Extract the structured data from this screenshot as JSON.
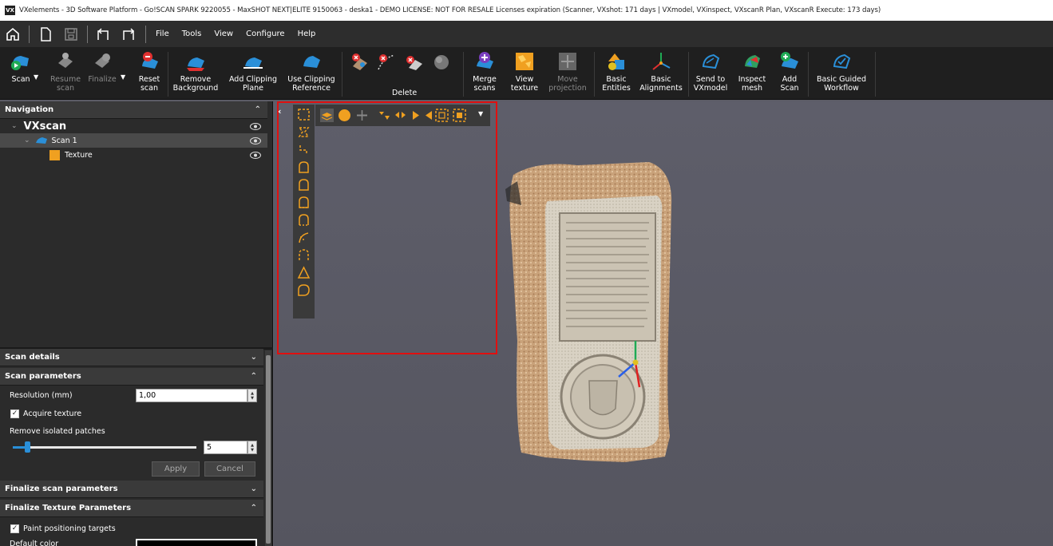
{
  "window": {
    "title": "VXelements - 3D Software Platform - Go!SCAN SPARK 9220055 - MaxSHOT NEXT|ELITE 9150063 - deska1 - DEMO LICENSE: NOT FOR RESALE Licenses expiration (Scanner, VXshot: 171 days | VXmodel, VXinspect, VXscanR Plan, VXscanR Execute: 173 days)",
    "logo": "VX"
  },
  "menu": {
    "items": [
      "File",
      "Tools",
      "View",
      "Configure",
      "Help"
    ]
  },
  "ribbon": {
    "scan": "Scan",
    "resume_scan": "Resume\nscan",
    "finalize": "Finalize",
    "reset_scan": "Reset\nscan",
    "remove_background": "Remove\nBackground",
    "add_clipping_plane": "Add Clipping\nPlane",
    "use_clipping_reference": "Use Clipping\nReference",
    "delete": "Delete",
    "merge_scans": "Merge\nscans",
    "view_texture": "View\ntexture",
    "move_projection": "Move\nprojection",
    "basic_entities": "Basic\nEntities",
    "basic_alignments": "Basic\nAlignments",
    "send_to_vxmodel": "Send to\nVXmodel",
    "inspect_mesh": "Inspect\nmesh",
    "add_scan": "Add\nScan",
    "basic_guided_workflow": "Basic Guided\nWorkflow"
  },
  "navigation": {
    "header": "Navigation",
    "root": "VXscan",
    "scan_item": "Scan 1",
    "texture_item": "Texture"
  },
  "scan_details": {
    "header": "Scan details"
  },
  "scan_parameters": {
    "header": "Scan parameters",
    "resolution_label": "Resolution (mm)",
    "resolution_value": "1,00",
    "acquire_texture": "Acquire texture",
    "remove_isolated_label": "Remove isolated patches",
    "remove_isolated_value": "5",
    "remove_isolated_slider_fraction": 0.08,
    "apply": "Apply",
    "cancel": "Cancel"
  },
  "finalize_scan_parameters": {
    "header": "Finalize scan parameters"
  },
  "finalize_texture_parameters": {
    "header": "Finalize Texture Parameters",
    "paint_positioning_targets": "Paint positioning targets",
    "default_color": "Default color"
  },
  "colors": {
    "accent_orange": "#f0a020",
    "highlight_red": "#e01010",
    "scan_blue": "#2a8fd8"
  }
}
